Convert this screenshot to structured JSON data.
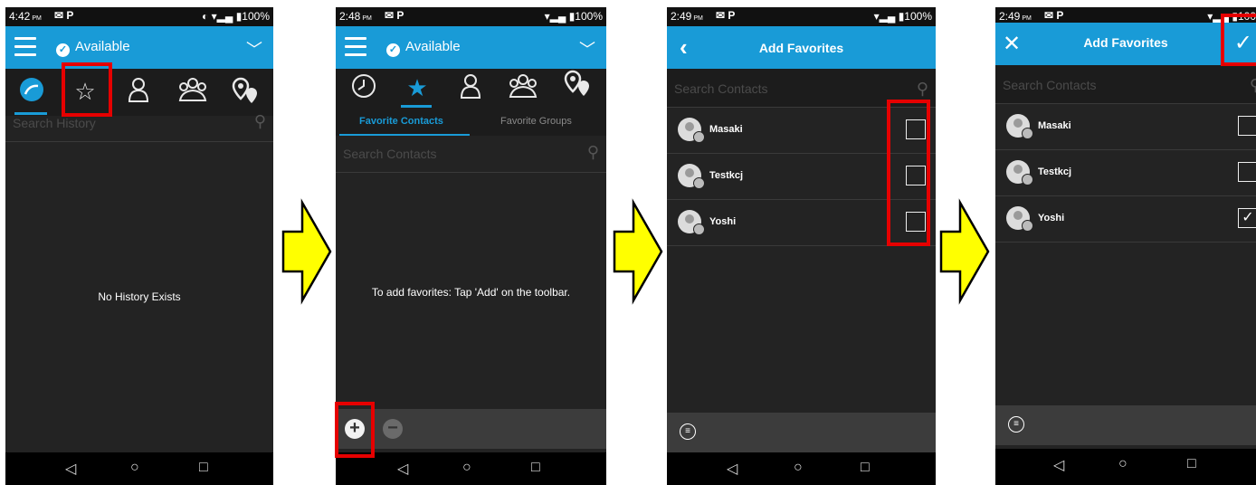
{
  "screen1": {
    "status_time": "4:42",
    "status_ampm": "PM",
    "status_right": "◐ ▾▂▄ ▮100%",
    "presence": "Available",
    "search_placeholder": "Search History",
    "empty_message": "No History Exists"
  },
  "screen2": {
    "status_time": "2:48",
    "status_ampm": "PM",
    "status_right": "▾▂▄ ▮100%",
    "presence": "Available",
    "subtab_contacts": "Favorite Contacts",
    "subtab_groups": "Favorite Groups",
    "search_placeholder": "Search Contacts",
    "empty_message": "To add favorites: Tap 'Add' on the toolbar."
  },
  "screen3": {
    "status_time": "2:49",
    "status_ampm": "PM",
    "status_right": "▾▂▄ ▮100%",
    "title": "Add Favorites",
    "search_placeholder": "Search Contacts",
    "contacts": [
      "Masaki",
      "Testkcj",
      "Yoshi"
    ]
  },
  "screen4": {
    "status_time": "2:49",
    "status_ampm": "PM",
    "status_right": "▾▂▄ ▮100",
    "title": "Add Favorites",
    "search_placeholder": "Search Contacts",
    "contacts": [
      "Masaki",
      "Testkcj",
      "Yoshi"
    ],
    "checked": [
      "Yoshi"
    ]
  },
  "status_icons": "✉ P",
  "colors": {
    "accent": "#199bd7",
    "highlight": "#e60000",
    "arrow": "#ffff00"
  }
}
